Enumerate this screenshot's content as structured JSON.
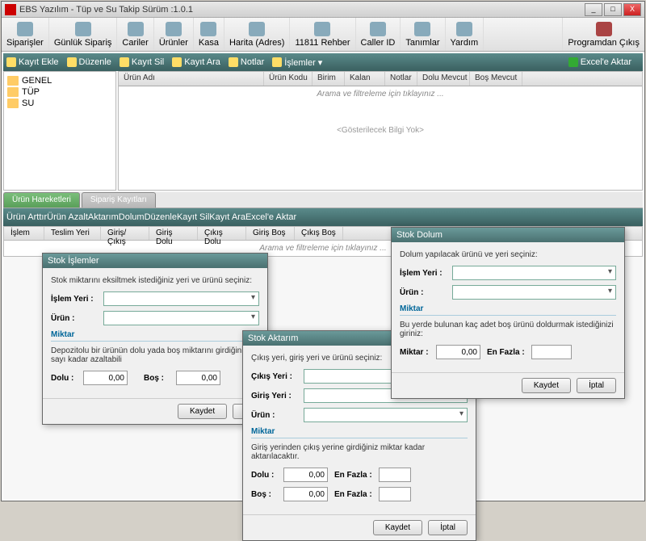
{
  "window": {
    "title": "EBS Yazılım - Tüp ve Su Takip Sürüm :1.0.1"
  },
  "toolbar": [
    {
      "label": "Siparişler"
    },
    {
      "label": "Günlük Sipariş"
    },
    {
      "label": "Cariler"
    },
    {
      "label": "Ürünler"
    },
    {
      "label": "Kasa"
    },
    {
      "label": "Harita (Adres)"
    },
    {
      "label": "11811 Rehber"
    },
    {
      "label": "Caller ID"
    },
    {
      "label": "Tanımlar"
    },
    {
      "label": "Yardım"
    }
  ],
  "toolbar_exit": "Programdan Çıkış",
  "subtoolbar1": [
    {
      "label": "Kayıt Ekle"
    },
    {
      "label": "Düzenle"
    },
    {
      "label": "Kayıt Sil"
    },
    {
      "label": "Kayıt Ara"
    },
    {
      "label": "Notlar"
    },
    {
      "label": "İşlemler ▾"
    }
  ],
  "excel": "Excel'e Aktar",
  "tree": [
    "GENEL",
    "TÜP",
    "SU"
  ],
  "cols1": [
    "Ürün Adı",
    "Ürün Kodu",
    "Birim",
    "Kalan",
    "Notlar",
    "Dolu Mevcut",
    "Boş Mevcut"
  ],
  "filter_hint": "Arama ve filtreleme  için tıklayınız ...",
  "empty": "<Gösterilecek Bilgi Yok>",
  "tabs": [
    "Ürün Hareketleri",
    "Sipariş Kayıtları"
  ],
  "subtoolbar2": [
    {
      "label": "Ürün Arttır"
    },
    {
      "label": "Ürün Azalt"
    },
    {
      "label": "Aktarım"
    },
    {
      "label": "Dolum"
    },
    {
      "label": "Düzenle"
    },
    {
      "label": "Kayıt Sil"
    },
    {
      "label": "Kayıt Ara"
    }
  ],
  "cols2": [
    "İşlem",
    "Teslim Yeri",
    "Giriş/Çıkış",
    "Giriş Dolu",
    "Çıkış Dolu",
    "Giriş Boş",
    "Çıkış Boş"
  ],
  "dlg_islem": {
    "title": "Stok İşlemler",
    "hint": "Stok miktarını eksiltmek istediğiniz yeri ve ürünü seçiniz:",
    "islem_yeri": "İşlem Yeri :",
    "urun": "Ürün :",
    "miktar": "Miktar",
    "hint2": "Depozitolu bir ürünün dolu yada boş miktarını girdiğiniz sayı kadar azaltabili",
    "dolu": "Dolu :",
    "bos": "Boş :",
    "v": "0,00",
    "kaydet": "Kaydet",
    "iptal": "İ"
  },
  "dlg_aktarim": {
    "title": "Stok Aktarım",
    "hint": "Çıkış yeri, giriş yeri ve ürünü seçiniz:",
    "cikis": "Çıkış Yeri :",
    "giris": "Giriş Yeri :",
    "urun": "Ürün :",
    "miktar": "Miktar",
    "hint2": "Giriş yerinden çıkış yerine girdiğiniz miktar kadar aktarılacaktır.",
    "dolu": "Dolu :",
    "bos": "Boş :",
    "enfazla": "En Fazla :",
    "v": "0,00",
    "kaydet": "Kaydet",
    "iptal": "İptal"
  },
  "dlg_dolum": {
    "title": "Stok Dolum",
    "hint": "Dolum yapılacak ürünü ve yeri seçiniz:",
    "islem_yeri": "İşlem Yeri :",
    "urun": "Ürün :",
    "miktar": "Miktar",
    "hint2": "Bu yerde bulunan kaç adet boş ürünü doldurmak istediğinizi giriniz:",
    "miktar_lbl": "Miktar :",
    "enfazla": "En Fazla :",
    "v": "0,00",
    "kaydet": "Kaydet",
    "iptal": "İptal"
  }
}
